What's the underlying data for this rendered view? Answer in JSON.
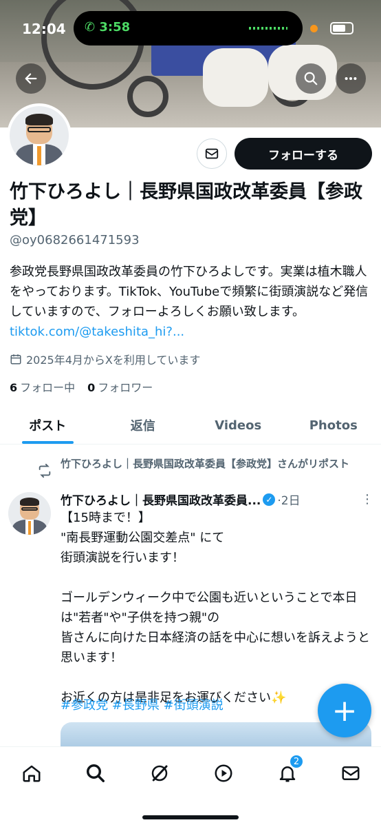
{
  "status_bar": {
    "time": "12:04",
    "call_time": "3:58"
  },
  "profile": {
    "name": "竹下ひろよし｜長野県国政改革委員【参政党】",
    "handle": "@oy0682661471593",
    "bio_text": "参政党長野県国政改革委員の竹下ひろよしです。実業は植木職人をやっております。TikTok、YouTubeで頻繁に街頭演説など発信していますので、フォローよろしくお願い致します。",
    "bio_link": "tiktok.com/@takeshita_hi?...",
    "joined": "2025年4月からXを利用しています",
    "following_count": "6",
    "following_label": "フォロー中",
    "followers_count": "0",
    "followers_label": "フォロワー",
    "follow_button": "フォローする"
  },
  "tabs": [
    {
      "label": "ポスト",
      "active": true
    },
    {
      "label": "返信",
      "active": false
    },
    {
      "label": "Videos",
      "active": false
    },
    {
      "label": "Photos",
      "active": false
    }
  ],
  "post": {
    "repost_label": "竹下ひろよし｜長野県国政改革委員【参政党】さんがリポスト",
    "author": "竹下ひろよし｜長野県国政改革委員...",
    "time": "·2日",
    "text": "【15時まで！】\n\"南長野運動公園交差点\" にて\n街頭演説を行います！\n\nゴールデンウィーク中で公園も近いということで本日は\"若者\"や\"子供を持つ親\"の\n皆さんに向けた日本経済の話を中心に想いを訴えようと思います！\n\nお近くの方は是非足をお運びください✨",
    "hashtags": "#参政党 #長野県 #街頭演説"
  },
  "nav": {
    "notifications_badge": "2"
  },
  "colors": {
    "accent": "#1d9bf0",
    "text": "#0f1419",
    "muted": "#536471"
  }
}
